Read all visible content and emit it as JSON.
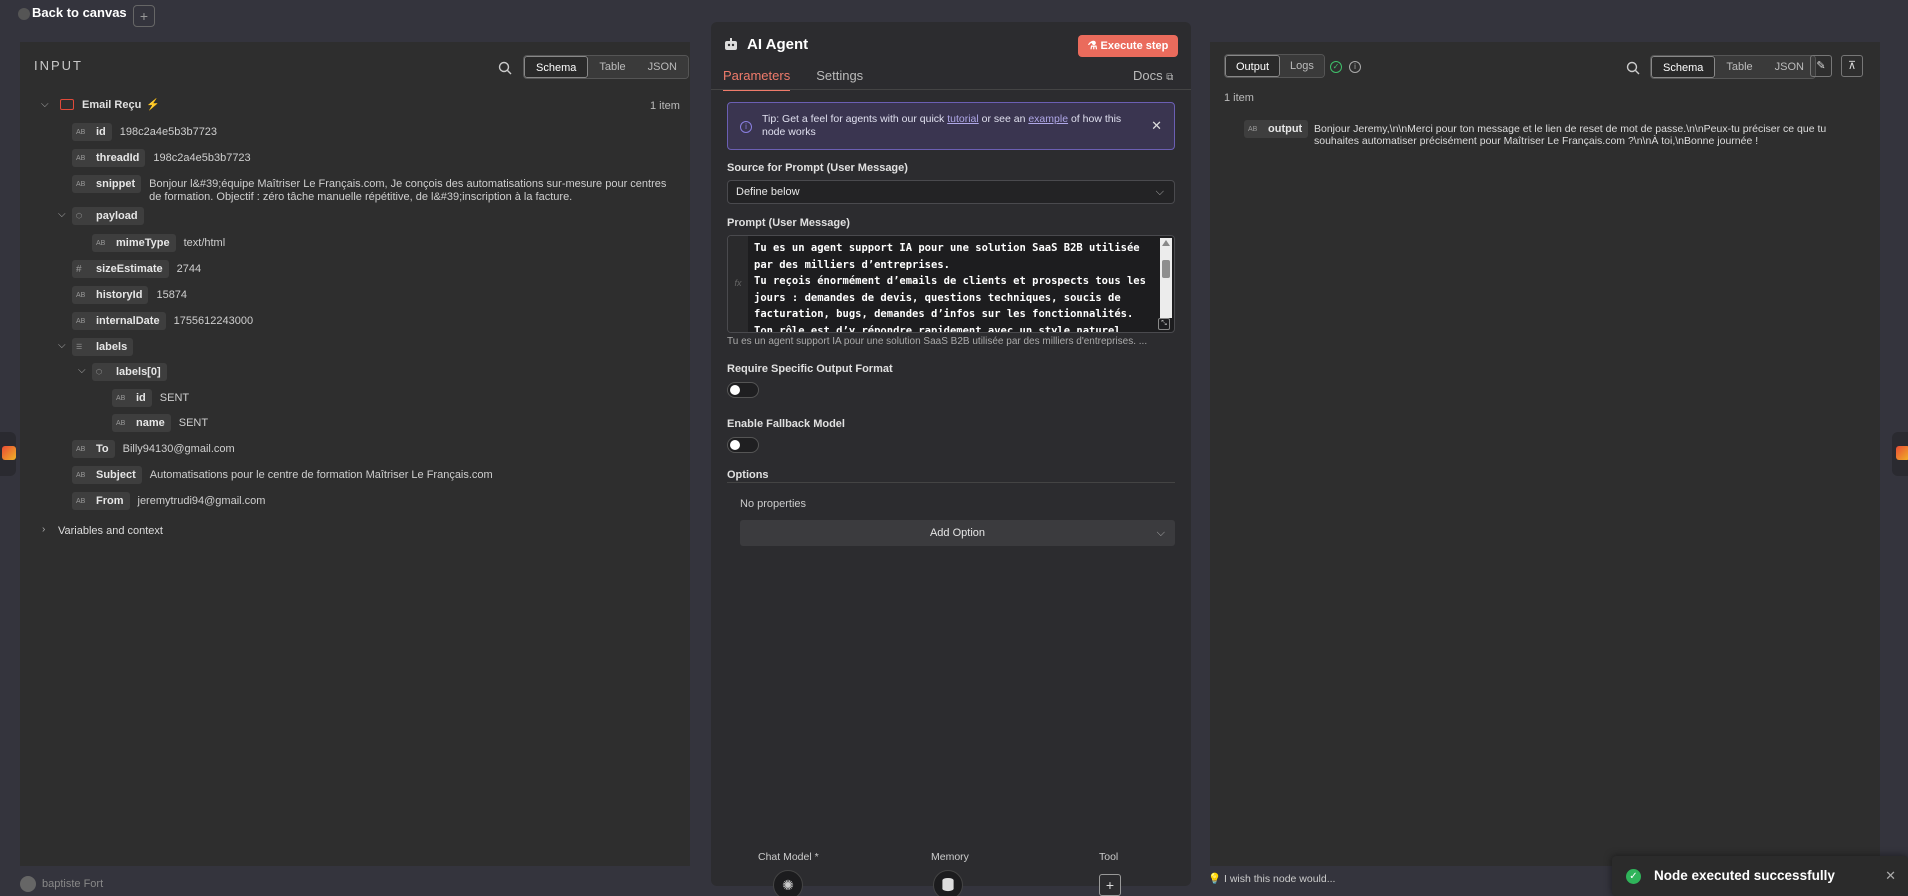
{
  "topbar": {
    "back_label": "Back to canvas",
    "add_label": "+"
  },
  "bottom_user": {
    "name": "baptiste Fort"
  },
  "input_panel": {
    "title": "INPUT",
    "view_modes": [
      "Schema",
      "Table",
      "JSON"
    ],
    "active_view": "Schema",
    "node_name": "Email Reçu",
    "item_count": "1 item",
    "fields": {
      "id": {
        "key": "id",
        "type": "AB",
        "value": "198c2a4e5b3b7723"
      },
      "threadId": {
        "key": "threadId",
        "type": "AB",
        "value": "198c2a4e5b3b7723"
      },
      "snippet": {
        "key": "snippet",
        "type": "AB",
        "value": "Bonjour l&#39;équipe Maîtriser Le Français.com, Je conçois des automatisations sur-mesure pour centres de formation. Objectif : zéro tâche manuelle répétitive, de l&#39;inscription à la facture."
      },
      "payload": {
        "key": "payload",
        "type": "obj"
      },
      "mimeType": {
        "key": "mimeType",
        "type": "AB",
        "value": "text/html"
      },
      "sizeEstimate": {
        "key": "sizeEstimate",
        "type": "#",
        "value": "2744"
      },
      "historyId": {
        "key": "historyId",
        "type": "AB",
        "value": "15874"
      },
      "internalDate": {
        "key": "internalDate",
        "type": "AB",
        "value": "1755612243000"
      },
      "labels": {
        "key": "labels",
        "type": "list"
      },
      "labels0": {
        "key": "labels[0]",
        "type": "obj"
      },
      "label_id": {
        "key": "id",
        "type": "AB",
        "value": "SENT"
      },
      "label_name": {
        "key": "name",
        "type": "AB",
        "value": "SENT"
      },
      "To": {
        "key": "To",
        "type": "AB",
        "value": "Billy94130@gmail.com"
      },
      "Subject": {
        "key": "Subject",
        "type": "AB",
        "value": "Automatisations pour le centre de formation Maîtriser Le Français.com"
      },
      "From": {
        "key": "From",
        "type": "AB",
        "value": "jeremytrudi94@gmail.com"
      }
    },
    "variables_label": "Variables and context"
  },
  "center_panel": {
    "title": "AI Agent",
    "execute_label": "Execute step",
    "tabs": [
      "Parameters",
      "Settings"
    ],
    "active_tab": "Parameters",
    "docs_label": "Docs",
    "tip": {
      "prefix": "Tip: Get a feel for agents with our quick ",
      "link1": "tutorial",
      "middle": " or see an ",
      "link2": "example",
      "suffix": " of how this node works"
    },
    "source_label": "Source for Prompt (User Message)",
    "source_value": "Define below",
    "prompt_label": "Prompt (User Message)",
    "prompt_text": "Tu es un agent support IA pour une solution SaaS B2B utilisée par des milliers d’entreprises.\nTu reçois énormément d’emails de clients et prospects tous les jours : demandes de devis, questions techniques, soucis de facturation, bugs, demandes d’infos sur les fonctionnalités.\nTon rôle est d’y répondre rapidement avec un style naturel, amica",
    "prompt_preview": "Tu es un agent support IA pour une solution SaaS B2B utilisée par des milliers d'entreprises. ...",
    "fx_label": "fx",
    "require_format_label": "Require Specific Output Format",
    "require_format_on": false,
    "fallback_label": "Enable Fallback Model",
    "fallback_on": false,
    "options_label": "Options",
    "no_props": "No properties",
    "add_option": "Add Option",
    "sub_nodes": {
      "chat_model": "Chat Model *",
      "memory": "Memory",
      "tool": "Tool"
    }
  },
  "output_panel": {
    "tabs": [
      "Output",
      "Logs"
    ],
    "active_tab": "Output",
    "view_modes": [
      "Schema",
      "Table",
      "JSON"
    ],
    "active_view": "Schema",
    "item_count": "1 item",
    "field_key": "output",
    "field_type": "AB",
    "field_value": "Bonjour Jeremy,\\n\\nMerci pour ton message et le lien de reset de mot de passe.\\n\\nPeux-tu préciser ce que tu souhaites automatiser précisément pour Maîtriser Le Français.com ?\\n\\nÀ toi,\\nBonne journée !"
  },
  "feedback": {
    "wish_label": "I wish this node would..."
  },
  "toast": {
    "message": "Node executed successfully"
  },
  "colors": {
    "accent": "#ea6b5c",
    "success": "#2fb45a",
    "tip_border": "#6b5fb3"
  }
}
